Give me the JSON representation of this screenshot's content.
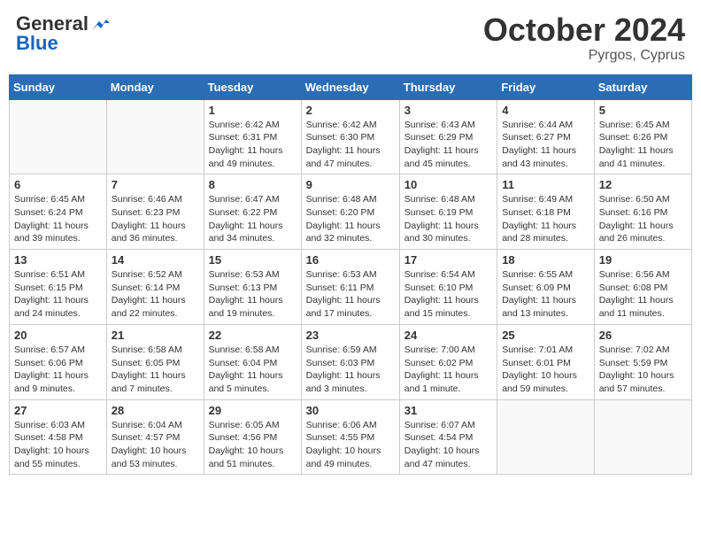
{
  "header": {
    "logo_line1": "General",
    "logo_line2": "Blue",
    "month": "October 2024",
    "location": "Pyrgos, Cyprus"
  },
  "days_of_week": [
    "Sunday",
    "Monday",
    "Tuesday",
    "Wednesday",
    "Thursday",
    "Friday",
    "Saturday"
  ],
  "weeks": [
    [
      {
        "day": "",
        "info": ""
      },
      {
        "day": "",
        "info": ""
      },
      {
        "day": "1",
        "info": "Sunrise: 6:42 AM\nSunset: 6:31 PM\nDaylight: 11 hours and 49 minutes."
      },
      {
        "day": "2",
        "info": "Sunrise: 6:42 AM\nSunset: 6:30 PM\nDaylight: 11 hours and 47 minutes."
      },
      {
        "day": "3",
        "info": "Sunrise: 6:43 AM\nSunset: 6:29 PM\nDaylight: 11 hours and 45 minutes."
      },
      {
        "day": "4",
        "info": "Sunrise: 6:44 AM\nSunset: 6:27 PM\nDaylight: 11 hours and 43 minutes."
      },
      {
        "day": "5",
        "info": "Sunrise: 6:45 AM\nSunset: 6:26 PM\nDaylight: 11 hours and 41 minutes."
      }
    ],
    [
      {
        "day": "6",
        "info": "Sunrise: 6:45 AM\nSunset: 6:24 PM\nDaylight: 11 hours and 39 minutes."
      },
      {
        "day": "7",
        "info": "Sunrise: 6:46 AM\nSunset: 6:23 PM\nDaylight: 11 hours and 36 minutes."
      },
      {
        "day": "8",
        "info": "Sunrise: 6:47 AM\nSunset: 6:22 PM\nDaylight: 11 hours and 34 minutes."
      },
      {
        "day": "9",
        "info": "Sunrise: 6:48 AM\nSunset: 6:20 PM\nDaylight: 11 hours and 32 minutes."
      },
      {
        "day": "10",
        "info": "Sunrise: 6:48 AM\nSunset: 6:19 PM\nDaylight: 11 hours and 30 minutes."
      },
      {
        "day": "11",
        "info": "Sunrise: 6:49 AM\nSunset: 6:18 PM\nDaylight: 11 hours and 28 minutes."
      },
      {
        "day": "12",
        "info": "Sunrise: 6:50 AM\nSunset: 6:16 PM\nDaylight: 11 hours and 26 minutes."
      }
    ],
    [
      {
        "day": "13",
        "info": "Sunrise: 6:51 AM\nSunset: 6:15 PM\nDaylight: 11 hours and 24 minutes."
      },
      {
        "day": "14",
        "info": "Sunrise: 6:52 AM\nSunset: 6:14 PM\nDaylight: 11 hours and 22 minutes."
      },
      {
        "day": "15",
        "info": "Sunrise: 6:53 AM\nSunset: 6:13 PM\nDaylight: 11 hours and 19 minutes."
      },
      {
        "day": "16",
        "info": "Sunrise: 6:53 AM\nSunset: 6:11 PM\nDaylight: 11 hours and 17 minutes."
      },
      {
        "day": "17",
        "info": "Sunrise: 6:54 AM\nSunset: 6:10 PM\nDaylight: 11 hours and 15 minutes."
      },
      {
        "day": "18",
        "info": "Sunrise: 6:55 AM\nSunset: 6:09 PM\nDaylight: 11 hours and 13 minutes."
      },
      {
        "day": "19",
        "info": "Sunrise: 6:56 AM\nSunset: 6:08 PM\nDaylight: 11 hours and 11 minutes."
      }
    ],
    [
      {
        "day": "20",
        "info": "Sunrise: 6:57 AM\nSunset: 6:06 PM\nDaylight: 11 hours and 9 minutes."
      },
      {
        "day": "21",
        "info": "Sunrise: 6:58 AM\nSunset: 6:05 PM\nDaylight: 11 hours and 7 minutes."
      },
      {
        "day": "22",
        "info": "Sunrise: 6:58 AM\nSunset: 6:04 PM\nDaylight: 11 hours and 5 minutes."
      },
      {
        "day": "23",
        "info": "Sunrise: 6:59 AM\nSunset: 6:03 PM\nDaylight: 11 hours and 3 minutes."
      },
      {
        "day": "24",
        "info": "Sunrise: 7:00 AM\nSunset: 6:02 PM\nDaylight: 11 hours and 1 minute."
      },
      {
        "day": "25",
        "info": "Sunrise: 7:01 AM\nSunset: 6:01 PM\nDaylight: 10 hours and 59 minutes."
      },
      {
        "day": "26",
        "info": "Sunrise: 7:02 AM\nSunset: 5:59 PM\nDaylight: 10 hours and 57 minutes."
      }
    ],
    [
      {
        "day": "27",
        "info": "Sunrise: 6:03 AM\nSunset: 4:58 PM\nDaylight: 10 hours and 55 minutes."
      },
      {
        "day": "28",
        "info": "Sunrise: 6:04 AM\nSunset: 4:57 PM\nDaylight: 10 hours and 53 minutes."
      },
      {
        "day": "29",
        "info": "Sunrise: 6:05 AM\nSunset: 4:56 PM\nDaylight: 10 hours and 51 minutes."
      },
      {
        "day": "30",
        "info": "Sunrise: 6:06 AM\nSunset: 4:55 PM\nDaylight: 10 hours and 49 minutes."
      },
      {
        "day": "31",
        "info": "Sunrise: 6:07 AM\nSunset: 4:54 PM\nDaylight: 10 hours and 47 minutes."
      },
      {
        "day": "",
        "info": ""
      },
      {
        "day": "",
        "info": ""
      }
    ]
  ]
}
